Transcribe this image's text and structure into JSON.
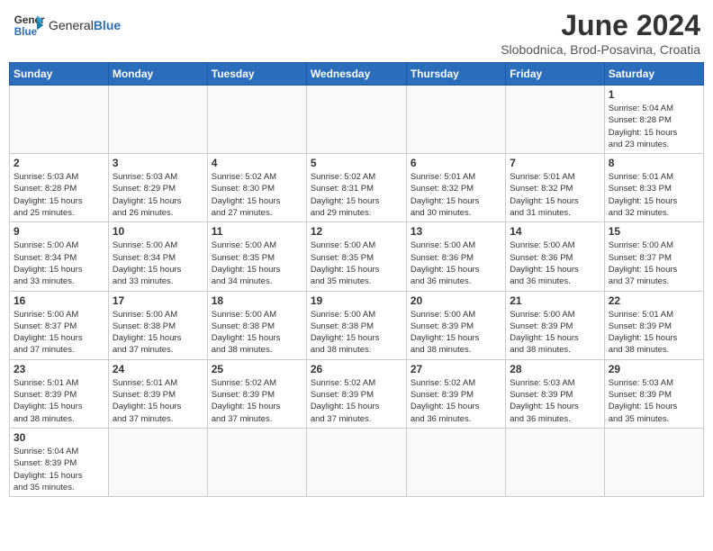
{
  "header": {
    "logo_text_normal": "General",
    "logo_text_bold": "Blue",
    "month_year": "June 2024",
    "location": "Slobodnica, Brod-Posavina, Croatia"
  },
  "weekdays": [
    "Sunday",
    "Monday",
    "Tuesday",
    "Wednesday",
    "Thursday",
    "Friday",
    "Saturday"
  ],
  "weeks": [
    [
      {
        "day": "",
        "info": ""
      },
      {
        "day": "",
        "info": ""
      },
      {
        "day": "",
        "info": ""
      },
      {
        "day": "",
        "info": ""
      },
      {
        "day": "",
        "info": ""
      },
      {
        "day": "",
        "info": ""
      },
      {
        "day": "1",
        "info": "Sunrise: 5:04 AM\nSunset: 8:28 PM\nDaylight: 15 hours\nand 23 minutes."
      }
    ],
    [
      {
        "day": "2",
        "info": "Sunrise: 5:03 AM\nSunset: 8:28 PM\nDaylight: 15 hours\nand 25 minutes."
      },
      {
        "day": "3",
        "info": "Sunrise: 5:03 AM\nSunset: 8:29 PM\nDaylight: 15 hours\nand 26 minutes."
      },
      {
        "day": "4",
        "info": "Sunrise: 5:02 AM\nSunset: 8:30 PM\nDaylight: 15 hours\nand 27 minutes."
      },
      {
        "day": "5",
        "info": "Sunrise: 5:02 AM\nSunset: 8:31 PM\nDaylight: 15 hours\nand 29 minutes."
      },
      {
        "day": "6",
        "info": "Sunrise: 5:01 AM\nSunset: 8:32 PM\nDaylight: 15 hours\nand 30 minutes."
      },
      {
        "day": "7",
        "info": "Sunrise: 5:01 AM\nSunset: 8:32 PM\nDaylight: 15 hours\nand 31 minutes."
      },
      {
        "day": "8",
        "info": "Sunrise: 5:01 AM\nSunset: 8:33 PM\nDaylight: 15 hours\nand 32 minutes."
      }
    ],
    [
      {
        "day": "9",
        "info": "Sunrise: 5:00 AM\nSunset: 8:34 PM\nDaylight: 15 hours\nand 33 minutes."
      },
      {
        "day": "10",
        "info": "Sunrise: 5:00 AM\nSunset: 8:34 PM\nDaylight: 15 hours\nand 33 minutes."
      },
      {
        "day": "11",
        "info": "Sunrise: 5:00 AM\nSunset: 8:35 PM\nDaylight: 15 hours\nand 34 minutes."
      },
      {
        "day": "12",
        "info": "Sunrise: 5:00 AM\nSunset: 8:35 PM\nDaylight: 15 hours\nand 35 minutes."
      },
      {
        "day": "13",
        "info": "Sunrise: 5:00 AM\nSunset: 8:36 PM\nDaylight: 15 hours\nand 36 minutes."
      },
      {
        "day": "14",
        "info": "Sunrise: 5:00 AM\nSunset: 8:36 PM\nDaylight: 15 hours\nand 36 minutes."
      },
      {
        "day": "15",
        "info": "Sunrise: 5:00 AM\nSunset: 8:37 PM\nDaylight: 15 hours\nand 37 minutes."
      }
    ],
    [
      {
        "day": "16",
        "info": "Sunrise: 5:00 AM\nSunset: 8:37 PM\nDaylight: 15 hours\nand 37 minutes."
      },
      {
        "day": "17",
        "info": "Sunrise: 5:00 AM\nSunset: 8:38 PM\nDaylight: 15 hours\nand 37 minutes."
      },
      {
        "day": "18",
        "info": "Sunrise: 5:00 AM\nSunset: 8:38 PM\nDaylight: 15 hours\nand 38 minutes."
      },
      {
        "day": "19",
        "info": "Sunrise: 5:00 AM\nSunset: 8:38 PM\nDaylight: 15 hours\nand 38 minutes."
      },
      {
        "day": "20",
        "info": "Sunrise: 5:00 AM\nSunset: 8:39 PM\nDaylight: 15 hours\nand 38 minutes."
      },
      {
        "day": "21",
        "info": "Sunrise: 5:00 AM\nSunset: 8:39 PM\nDaylight: 15 hours\nand 38 minutes."
      },
      {
        "day": "22",
        "info": "Sunrise: 5:01 AM\nSunset: 8:39 PM\nDaylight: 15 hours\nand 38 minutes."
      }
    ],
    [
      {
        "day": "23",
        "info": "Sunrise: 5:01 AM\nSunset: 8:39 PM\nDaylight: 15 hours\nand 38 minutes."
      },
      {
        "day": "24",
        "info": "Sunrise: 5:01 AM\nSunset: 8:39 PM\nDaylight: 15 hours\nand 37 minutes."
      },
      {
        "day": "25",
        "info": "Sunrise: 5:02 AM\nSunset: 8:39 PM\nDaylight: 15 hours\nand 37 minutes."
      },
      {
        "day": "26",
        "info": "Sunrise: 5:02 AM\nSunset: 8:39 PM\nDaylight: 15 hours\nand 37 minutes."
      },
      {
        "day": "27",
        "info": "Sunrise: 5:02 AM\nSunset: 8:39 PM\nDaylight: 15 hours\nand 36 minutes."
      },
      {
        "day": "28",
        "info": "Sunrise: 5:03 AM\nSunset: 8:39 PM\nDaylight: 15 hours\nand 36 minutes."
      },
      {
        "day": "29",
        "info": "Sunrise: 5:03 AM\nSunset: 8:39 PM\nDaylight: 15 hours\nand 35 minutes."
      }
    ],
    [
      {
        "day": "30",
        "info": "Sunrise: 5:04 AM\nSunset: 8:39 PM\nDaylight: 15 hours\nand 35 minutes."
      },
      {
        "day": "",
        "info": ""
      },
      {
        "day": "",
        "info": ""
      },
      {
        "day": "",
        "info": ""
      },
      {
        "day": "",
        "info": ""
      },
      {
        "day": "",
        "info": ""
      },
      {
        "day": "",
        "info": ""
      }
    ]
  ]
}
